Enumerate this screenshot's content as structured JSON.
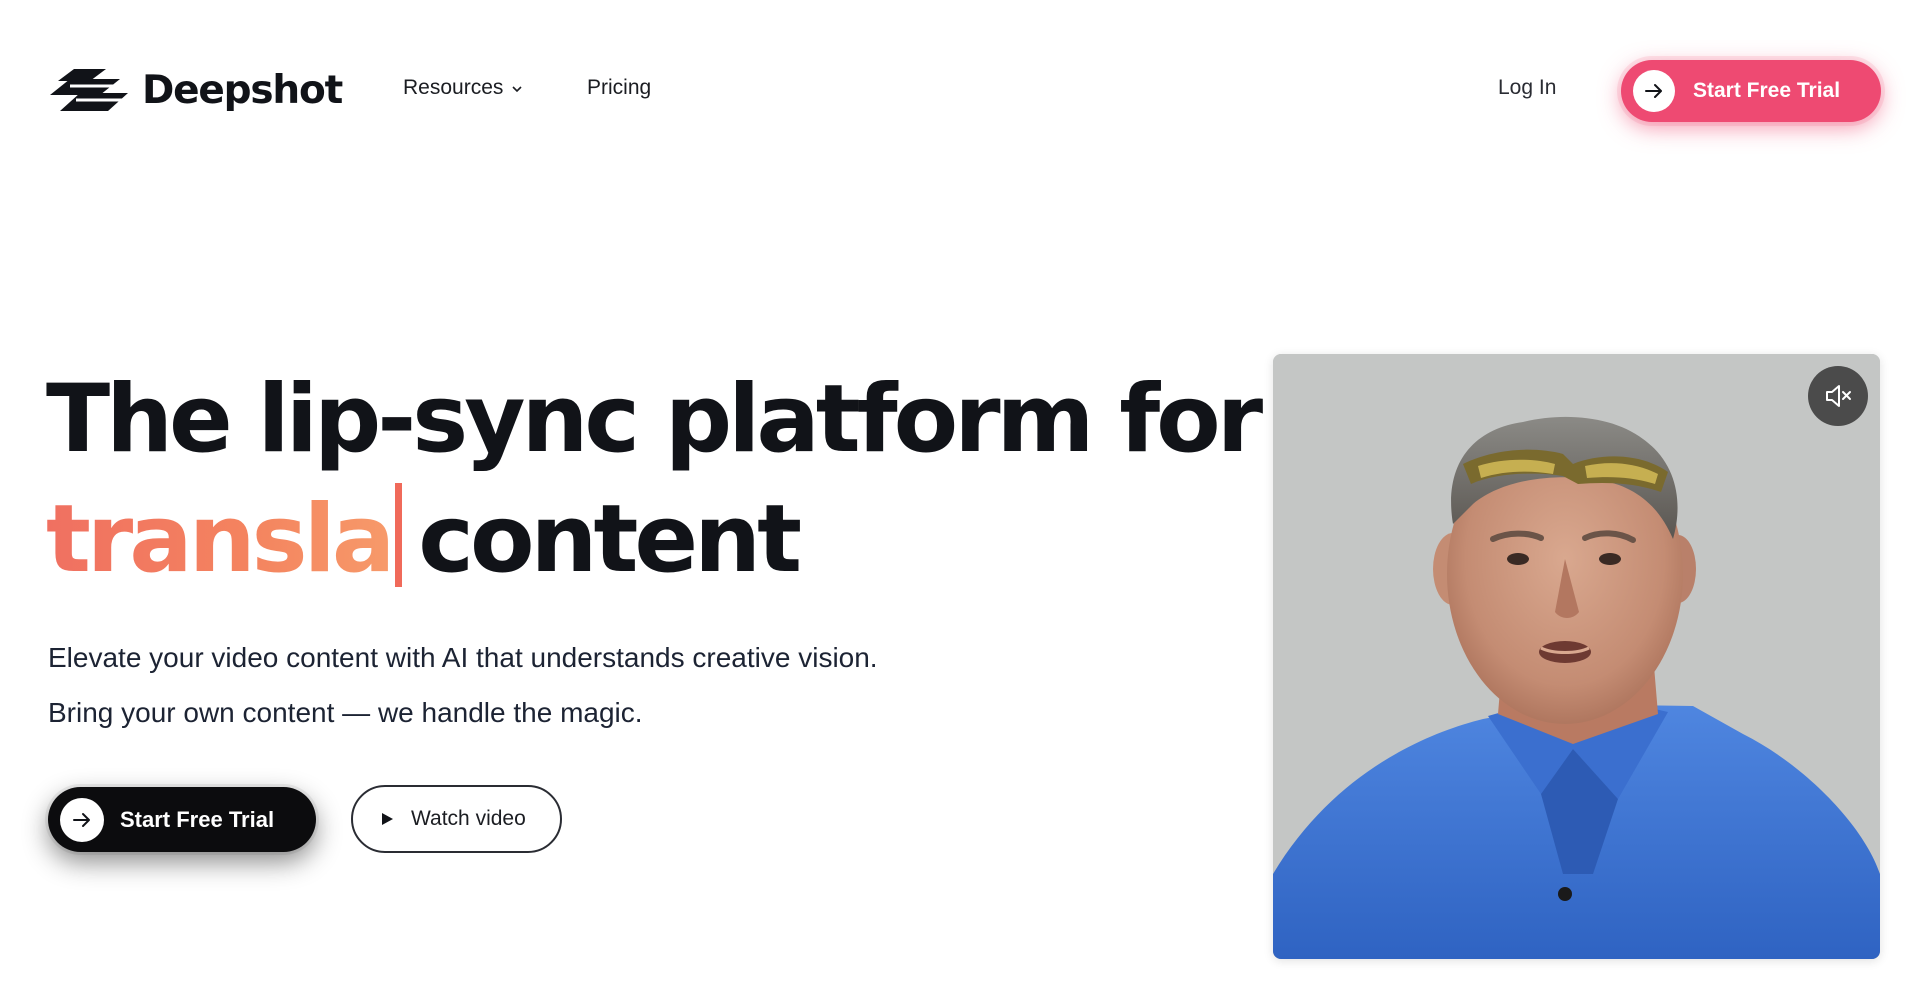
{
  "brand": {
    "name": "Deepshot"
  },
  "nav": {
    "resources_label": "Resources",
    "pricing_label": "Pricing",
    "login_label": "Log In",
    "cta_label": "Start Free Trial"
  },
  "hero": {
    "title_line1": "The lip-sync platform for",
    "title_typed_word": "transla",
    "title_line2_rest": "content",
    "subtitle_line1": "Elevate your video content with AI that understands creative vision.",
    "subtitle_line2": "Bring your own content — we handle the magic.",
    "primary_cta_label": "Start Free Trial",
    "secondary_cta_label": "Watch video"
  },
  "video": {
    "mute_icon": "speaker-muted-icon",
    "muted": true
  },
  "colors": {
    "accent_pink": "#ee4a72",
    "typed_gradient_start": "#f07061",
    "typed_gradient_end": "#f79a6a",
    "dark": "#0c0c0e"
  }
}
